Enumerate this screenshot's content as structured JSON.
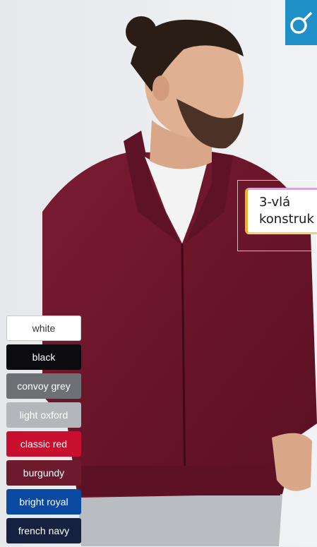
{
  "product": {
    "gender_icon": "male-symbol-icon",
    "feature_label": [
      "3-vlá",
      "konstruk"
    ]
  },
  "colors": [
    {
      "name": "white",
      "bg": "#ffffff",
      "fg": "#333333"
    },
    {
      "name": "black",
      "bg": "#0b0b10",
      "fg": "#ffffff"
    },
    {
      "name": "convoy grey",
      "bg": "#6e7075",
      "fg": "#ffffff"
    },
    {
      "name": "light oxford",
      "bg": "#b3b6ba",
      "fg": "#ffffff"
    },
    {
      "name": "classic red",
      "bg": "#c8102e",
      "fg": "#ffffff"
    },
    {
      "name": "burgundy",
      "bg": "#6d1a2c",
      "fg": "#ffffff"
    },
    {
      "name": "bright royal",
      "bg": "#0a49a1",
      "fg": "#ffffff"
    },
    {
      "name": "french navy",
      "bg": "#15213f",
      "fg": "#ffffff"
    }
  ]
}
